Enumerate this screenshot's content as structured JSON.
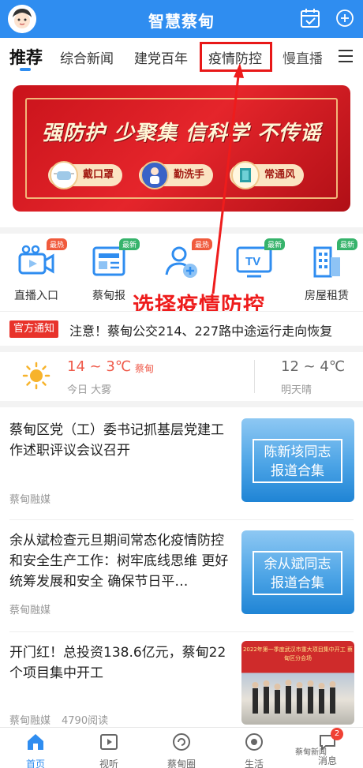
{
  "header": {
    "title": "智慧蔡甸"
  },
  "tabs": [
    {
      "label": "推荐"
    },
    {
      "label": "综合新闻"
    },
    {
      "label": "建党百年"
    },
    {
      "label": "疫情防控"
    },
    {
      "label": "慢直播"
    }
  ],
  "banner": {
    "headline": "强防护 少聚集 信科学 不传谣",
    "chips": [
      {
        "label": "戴口罩"
      },
      {
        "label": "勤洗手"
      },
      {
        "label": "常通风"
      }
    ]
  },
  "shortcuts": [
    {
      "label": "直播入口",
      "badge": "最热",
      "icon": "live-camera-icon"
    },
    {
      "label": "蔡甸报",
      "badge": "最新",
      "icon": "newspaper-icon"
    },
    {
      "label": "",
      "badge": "最热",
      "icon": "user-add-icon"
    },
    {
      "label": "",
      "badge": "最新",
      "icon": "tv-icon"
    },
    {
      "label": "房屋租赁",
      "badge": "最新",
      "icon": "building-icon"
    }
  ],
  "annotation": "选择疫情防控",
  "notice": {
    "tag": "官方通知",
    "text": "注意！蔡甸公交214、227路中途运行走向恢复"
  },
  "weather": {
    "today_temp": "14 ~ 3℃",
    "location": "蔡甸",
    "today_desc": "今日 大雾",
    "tomorrow_temp": "12 ~ 4℃",
    "tomorrow_desc": "明天晴"
  },
  "articles": [
    {
      "title": "蔡甸区党（工）委书记抓基层党建工作述职评议会议召开",
      "source": "蔡甸融媒",
      "reads": "",
      "thumb_text": "陈新垓同志\n报道合集"
    },
    {
      "title": "余从斌检查元旦期间常态化疫情防控和安全生产工作：树牢底线思维 更好统筹发展和安全 确保节日平…",
      "source": "蔡甸融媒",
      "reads": "",
      "thumb_text": "余从斌同志\n报道合集"
    },
    {
      "title": "开门红！总投资138.6亿元，蔡甸22个项目集中开工",
      "source": "蔡甸融媒",
      "reads": "4790阅读",
      "thumb_caption": "2022年第一季度武汉市重大项目集中开工 蔡甸区分会场"
    }
  ],
  "bottom_nav": [
    {
      "label": "首页"
    },
    {
      "label": "视听"
    },
    {
      "label": "蔡甸圈"
    },
    {
      "label": "生活"
    },
    {
      "label": "消息",
      "badge": "2"
    }
  ],
  "watermark": "蔡甸新闻",
  "colors": {
    "brand": "#2f8df0",
    "highlight": "#e81818",
    "banner": "#d61c22"
  }
}
